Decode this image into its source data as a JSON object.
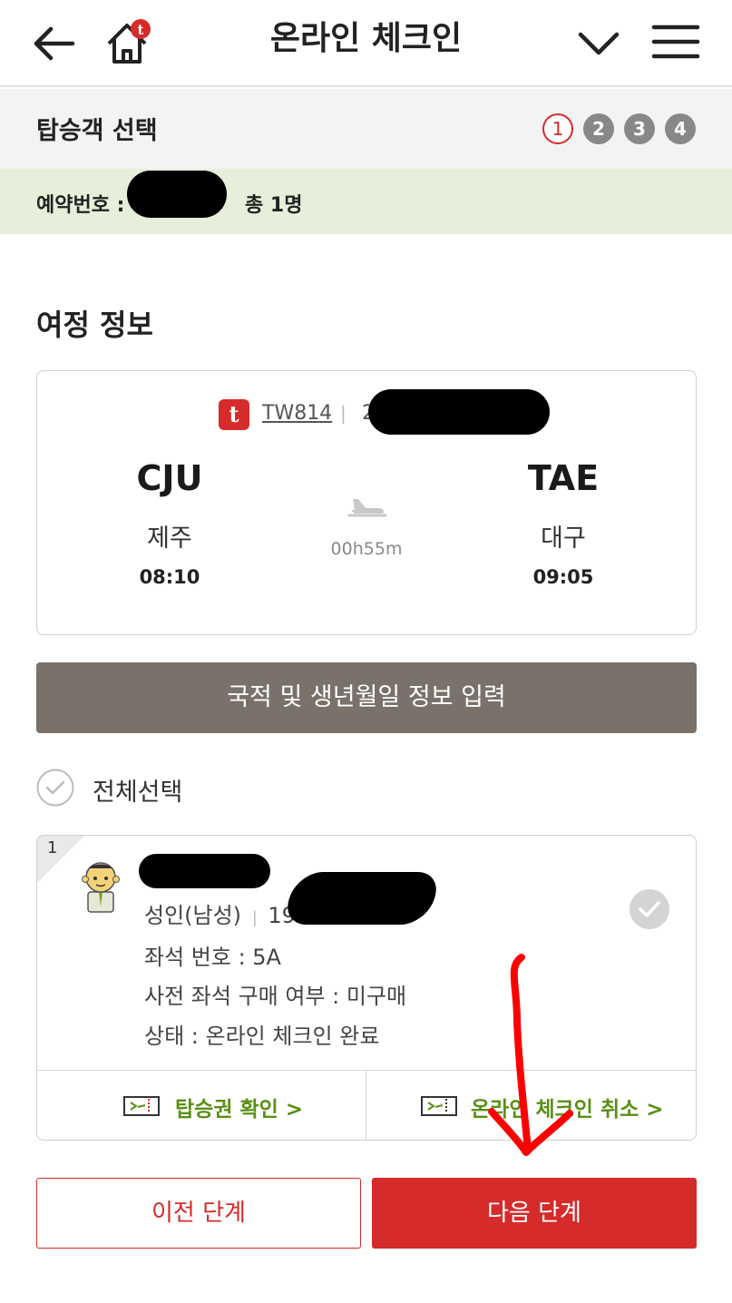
{
  "header": {
    "title": "온라인 체크인"
  },
  "steps": {
    "title": "탑승객 선택",
    "items": [
      "1",
      "2",
      "3",
      "4"
    ],
    "active": 1
  },
  "reservation": {
    "label": "예약번호 :",
    "count_text": "총 1명"
  },
  "itinerary": {
    "section_title": "여정 정보",
    "airline_logo_letter": "t",
    "flight_number": "TW814",
    "separator": "|",
    "date_prefix": "202",
    "departure": {
      "code": "CJU",
      "city": "제주",
      "time": "08:10"
    },
    "arrival": {
      "code": "TAE",
      "city": "대구",
      "time": "09:05"
    },
    "duration": "00h55m"
  },
  "actions": {
    "info_button": "국적 및 생년월일 정보 입력",
    "select_all": "전체선택"
  },
  "passenger": {
    "index": "1",
    "type_gender": "성인(남성)",
    "separator": "|",
    "dob_prefix": "19",
    "seat": "좌석 번호 : 5A",
    "prepaid_seat": "사전 좌석 구매 여부 : 미구매",
    "status": "상태 : 온라인 체크인 완료",
    "boarding_pass_link": "탑승권 확인 >",
    "cancel_checkin_link": "온라인 체크인 취소 >"
  },
  "footer": {
    "prev_button": "이전 단계",
    "next_button": "다음 단계"
  },
  "colors": {
    "brand_red": "#d52b2b",
    "link_green": "#5a8f16",
    "info_button_bg": "#7a716b",
    "reservation_bar_bg": "#e5efd9"
  }
}
